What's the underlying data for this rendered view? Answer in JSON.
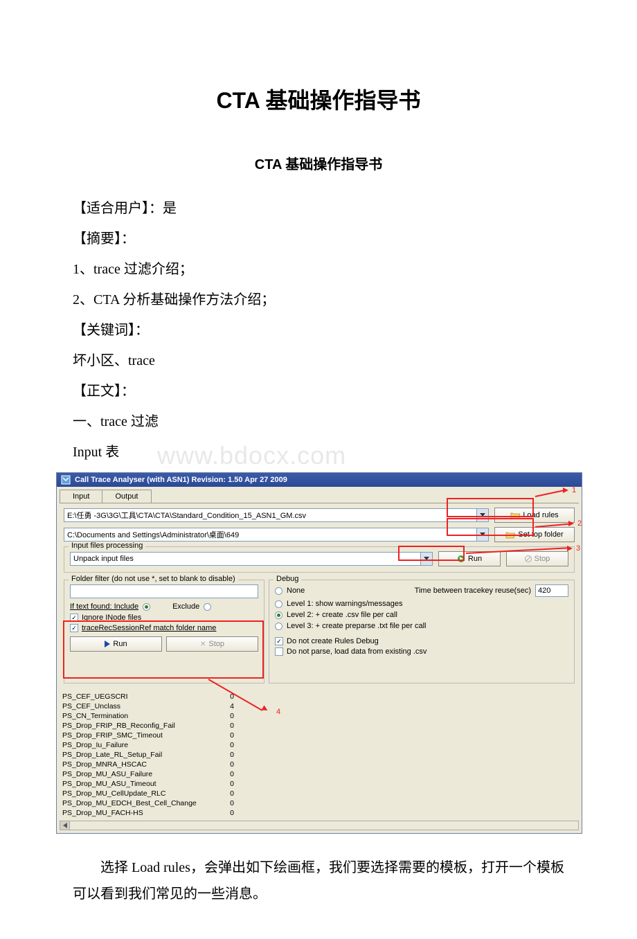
{
  "doc": {
    "main_title": "CTA 基础操作指导书",
    "sub_title": "CTA 基础操作指导书",
    "p_user": "【适合用户】：是",
    "p_summary_h": "【摘要】：",
    "p_sum1": "1、trace 过滤介绍；",
    "p_sum2": "2、CTA 分析基础操作方法介绍；",
    "p_kw_h": "【关键词】：",
    "p_kw": "坏小区、trace",
    "p_body_h": "【正文】：",
    "p_sec1": "一、trace 过滤",
    "p_input": "Input 表",
    "watermark": "www.bdocx.com",
    "p_after": "选择 Load rules，会弹出如下绘画框，我们要选择需要的模板，打开一个模板可以看到我们常见的一些消息。"
  },
  "app": {
    "title": "Call Trace Analyser (with ASN1) Revision: 1.50    Apr 27 2009",
    "tabs": {
      "input": "Input",
      "output": "Output"
    },
    "path_rules": "E:\\任勇 -3G\\3G\\工具\\CTA\\CTA\\Standard_Condition_15_ASN1_GM.csv",
    "path_folder": "C:\\Documents and Settings\\Administrator\\桌面\\649",
    "btn_load_rules": "Load rules",
    "btn_set_top": "Set top folder",
    "fs_input": "Input files processing",
    "combo_unpack": "Unpack input files",
    "btn_run": "Run",
    "btn_stop": "Stop",
    "fs_filter": "Folder filter (do not use *, set to blank to disable)",
    "filter_label": "If text found: Include",
    "filter_exclude": "Exclude",
    "chk_ignore": "Ignore INode files",
    "chk_tracerec": "traceRecSessionRef match folder name",
    "fs_debug": "Debug",
    "dbg_none": "None",
    "dbg_time": "Time between tracekey reuse(sec)",
    "dbg_time_val": "420",
    "dbg_l1": "Level 1: show warnings/messages",
    "dbg_l2": "Level 2: + create .csv file per call",
    "dbg_l3": "Level 3: + create preparse .txt file per call",
    "dbg_norules": "Do not create Rules Debug",
    "dbg_noparse": "Do not parse, load data from existing .csv",
    "anno": {
      "n1": "1",
      "n2": "2",
      "n3": "3",
      "n4": "4"
    },
    "results": [
      {
        "name": "PS_CEF_UEGSCRI",
        "val": "0"
      },
      {
        "name": "PS_CEF_Unclass",
        "val": "4"
      },
      {
        "name": "PS_CN_Termination",
        "val": "0"
      },
      {
        "name": "PS_Drop_FRIP_RB_Reconfig_Fail",
        "val": "0"
      },
      {
        "name": "PS_Drop_FRIP_SMC_Timeout",
        "val": "0"
      },
      {
        "name": "PS_Drop_Iu_Failure",
        "val": "0"
      },
      {
        "name": "PS_Drop_Late_RL_Setup_Fail",
        "val": "0"
      },
      {
        "name": "PS_Drop_MNRA_HSCAC",
        "val": "0"
      },
      {
        "name": "PS_Drop_MU_ASU_Failure",
        "val": "0"
      },
      {
        "name": "PS_Drop_MU_ASU_Timeout",
        "val": "0"
      },
      {
        "name": "PS_Drop_MU_CellUpdate_RLC",
        "val": "0"
      },
      {
        "name": "PS_Drop_MU_EDCH_Best_Cell_Change",
        "val": "0"
      },
      {
        "name": "PS_Drop_MU_FACH-HS",
        "val": "0"
      }
    ]
  }
}
